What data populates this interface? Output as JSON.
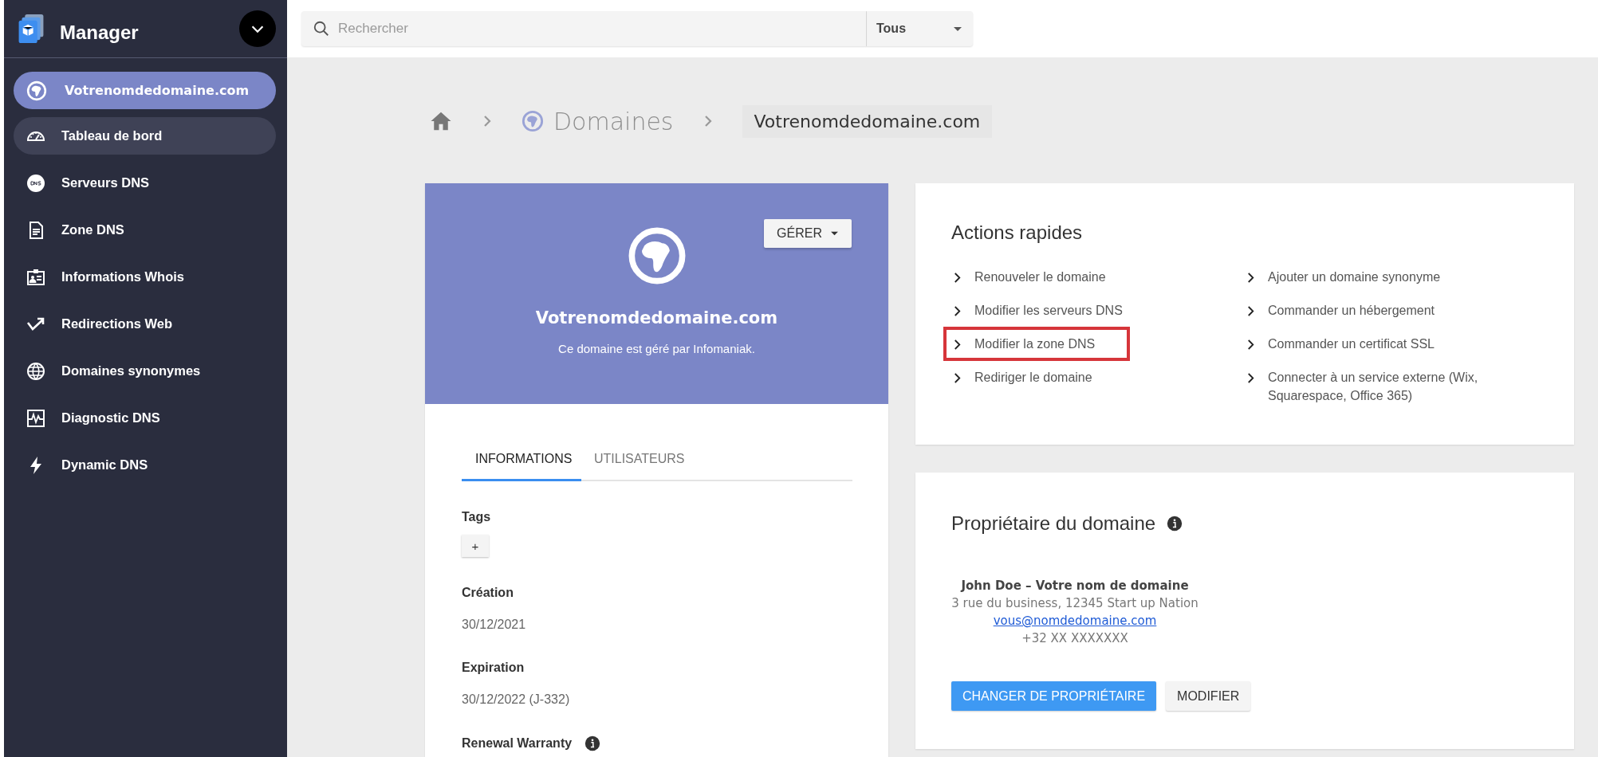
{
  "sidebar": {
    "logo": "Manager",
    "domain_button": {
      "label": "Votrenomdedomaine.com"
    },
    "items": [
      {
        "label": "Tableau de bord",
        "selected": true
      },
      {
        "label": "Serveurs DNS",
        "selected": false
      },
      {
        "label": "Zone DNS",
        "selected": false
      },
      {
        "label": "Informations Whois",
        "selected": false
      },
      {
        "label": "Redirections Web",
        "selected": false
      },
      {
        "label": "Domaines synonymes",
        "selected": false
      },
      {
        "label": "Diagnostic DNS",
        "selected": false
      },
      {
        "label": "Dynamic DNS",
        "selected": false
      }
    ]
  },
  "search": {
    "placeholder": "Rechercher",
    "scope": "Tous"
  },
  "breadcrumb": [
    "Domaines",
    "Votrenomdedomaine.com"
  ],
  "domain_card": {
    "title": "Votrenomdedomaine.com",
    "subtitle": "Ce domaine est géré par Infomaniak.",
    "manage_button": "GÉRER",
    "tabs": [
      {
        "label": "INFORMATIONS",
        "selected": true
      },
      {
        "label": "UTILISATEURS",
        "selected": false
      }
    ],
    "fields": [
      {
        "kind": "tags",
        "label": "Tags",
        "button": "+"
      },
      {
        "kind": "value",
        "label": "Création",
        "value": "30/12/2021"
      },
      {
        "kind": "value",
        "label": "Expiration",
        "value": "30/12/2022 (J-332)"
      },
      {
        "kind": "info",
        "label": "Renewal Warranty"
      }
    ]
  },
  "quick_actions": {
    "title": "Actions rapides",
    "columns": [
      [
        {
          "label": "Renouveler le domaine",
          "highlighted": false
        },
        {
          "label": "Modifier les serveurs DNS",
          "highlighted": false
        },
        {
          "label": "Modifier la zone DNS",
          "highlighted": true
        },
        {
          "label": "Rediriger le domaine",
          "highlighted": false
        }
      ],
      [
        {
          "label": "Ajouter un domaine synonyme",
          "highlighted": false
        },
        {
          "label": "Commander un hébergement",
          "highlighted": false
        },
        {
          "label": "Commander un certificat SSL",
          "highlighted": false
        },
        {
          "label": "Connecter à un service externe (Wix, Squarespace, Office 365)",
          "highlighted": false
        }
      ]
    ]
  },
  "owner": {
    "title": "Propriétaire du domaine",
    "name": "John Doe – Votre nom de domaine",
    "address": "3 rue du business, 12345 Start up Nation",
    "email": "vous@nomdedomaine.com",
    "phone": "+32 XX XXXXXXX",
    "buttons": [
      {
        "label": "CHANGER DE PROPRIÉTAIRE",
        "kind": "primary"
      },
      {
        "label": "MODIFIER",
        "kind": "secondary"
      }
    ]
  }
}
